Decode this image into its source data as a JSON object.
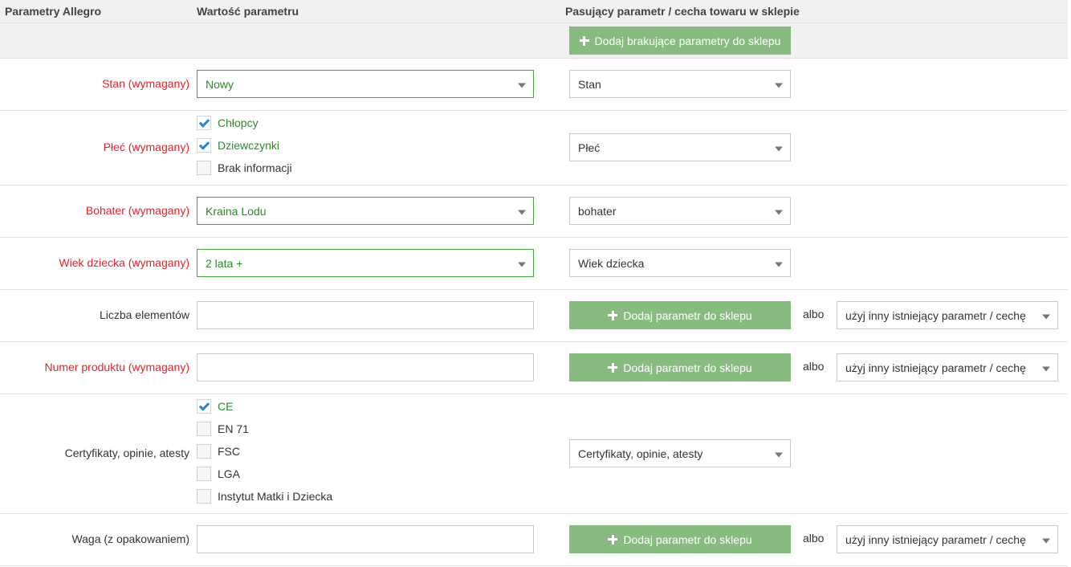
{
  "header": {
    "col_param": "Parametry Allegro",
    "col_value": "Wartość parametru",
    "col_match": "Pasujący parametr / cecha towaru w sklepie"
  },
  "top_button": "Dodaj brakujące parametry do sklepu",
  "rows": {
    "stan": {
      "label": "Stan (wymagany)",
      "value": "Nowy",
      "match": "Stan"
    },
    "plec": {
      "label": "Płeć (wymagany)",
      "options": [
        "Chłopcy",
        "Dziewczynki",
        "Brak informacji"
      ],
      "checked": [
        "Chłopcy",
        "Dziewczynki"
      ],
      "match": "Płeć"
    },
    "bohater": {
      "label": "Bohater (wymagany)",
      "value": "Kraina Lodu",
      "match": "bohater"
    },
    "wiek": {
      "label": "Wiek dziecka (wymagany)",
      "value": "2 lata +",
      "match": "Wiek dziecka"
    },
    "liczba": {
      "label": "Liczba elementów",
      "value": "",
      "button": "Dodaj parametr do sklepu",
      "or": "albo",
      "alt_select": "użyj inny istniejący parametr / cechę"
    },
    "numer": {
      "label": "Numer produktu (wymagany)",
      "value": "",
      "button": "Dodaj parametr do sklepu",
      "or": "albo",
      "alt_select": "użyj inny istniejący parametr / cechę"
    },
    "certyfikaty": {
      "label": "Certyfikaty, opinie, atesty",
      "options": [
        "CE",
        "EN 71",
        "FSC",
        "LGA",
        "Instytut Matki i Dziecka"
      ],
      "checked": [
        "CE"
      ],
      "match": "Certyfikaty, opinie, atesty"
    },
    "waga": {
      "label": "Waga (z opakowaniem)",
      "value": "",
      "button": "Dodaj parametr do sklepu",
      "or": "albo",
      "alt_select": "użyj inny istniejący parametr / cechę"
    }
  },
  "colors": {
    "required_label": "#e0242e",
    "selected_value": "#2b8a2b",
    "button_bg": "#88bb80",
    "check_mark": "#2a86c9"
  }
}
